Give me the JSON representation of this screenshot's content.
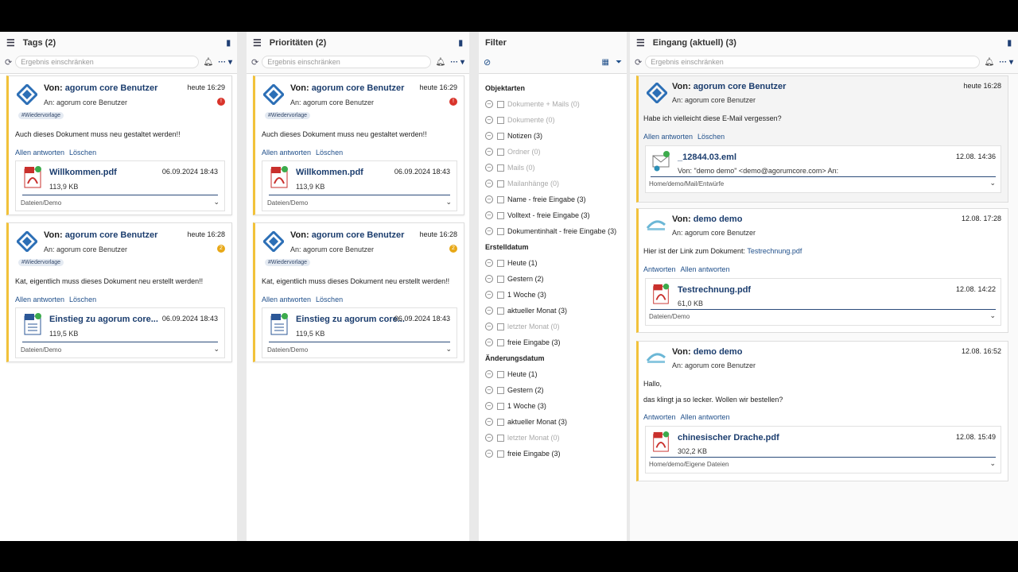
{
  "panels": {
    "tags": {
      "title": "Tags (2)",
      "search_placeholder": "Ergebnis einschränken"
    },
    "prio": {
      "title": "Prioritäten (2)",
      "search_placeholder": "Ergebnis einschränken"
    },
    "filter": {
      "title": "Filter"
    },
    "inbox": {
      "title": "Eingang (aktuell) (3)",
      "search_placeholder": "Ergebnis einschränken"
    }
  },
  "common": {
    "from_label": "Von:",
    "sender": "agorum core Benutzer",
    "to": "An: agorum core Benutzer",
    "tag": "#Wiedervorlage",
    "reply_all": "Allen antworten",
    "delete": "Löschen",
    "reply": "Antworten",
    "path_demo": "Dateien/Demo"
  },
  "cards": [
    {
      "time": "heute 16:29",
      "badge": "!",
      "message": "Auch dieses Dokument muss neu gestaltet werden!!",
      "file": "Willkommen.pdf",
      "file_date": "06.09.2024 18:43",
      "size_a": "113,9 KB"
    },
    {
      "time": "heute 16:28",
      "badge": "2",
      "message": "Kat, eigentlich muss dieses Dokument neu erstellt werden!!",
      "file": "Einstieg zu agorum core...",
      "file_date": "06.09.2024 18:43",
      "size_a": "119,5 KB"
    }
  ],
  "filter": {
    "sections": [
      {
        "title": "Objektarten",
        "items": [
          {
            "label": "Dokumente + Mails (0)",
            "dim": true
          },
          {
            "label": "Dokumente (0)",
            "dim": true
          },
          {
            "label": "Notizen (3)",
            "dim": false
          },
          {
            "label": "Ordner (0)",
            "dim": true
          },
          {
            "label": "Mails (0)",
            "dim": true
          },
          {
            "label": "Mailanhänge (0)",
            "dim": true
          },
          {
            "label": "Name - freie Eingabe (3)",
            "dim": false
          },
          {
            "label": "Volltext - freie Eingabe (3)",
            "dim": false
          },
          {
            "label": "Dokumentinhalt - freie Eingabe (3)",
            "dim": false
          }
        ]
      },
      {
        "title": "Erstelldatum",
        "items": [
          {
            "label": "Heute (1)",
            "dim": false
          },
          {
            "label": "Gestern (2)",
            "dim": false
          },
          {
            "label": "1 Woche (3)",
            "dim": false
          },
          {
            "label": "aktueller Monat (3)",
            "dim": false
          },
          {
            "label": "letzter Monat (0)",
            "dim": true
          },
          {
            "label": "freie Eingabe (3)",
            "dim": false
          }
        ]
      },
      {
        "title": "Änderungsdatum",
        "items": [
          {
            "label": "Heute (1)",
            "dim": false
          },
          {
            "label": "Gestern (2)",
            "dim": false
          },
          {
            "label": "1 Woche (3)",
            "dim": false
          },
          {
            "label": "aktueller Monat (3)",
            "dim": false
          },
          {
            "label": "letzter Monat (0)",
            "dim": true
          },
          {
            "label": "freie Eingabe (3)",
            "dim": false
          }
        ]
      }
    ]
  },
  "inbox": [
    {
      "sender": "agorum core Benutzer",
      "time": "heute 16:28",
      "body1": "Habe ich vielleicht diese E-Mail vergessen?",
      "body2": "",
      "actions": [
        "Allen antworten",
        "Löschen"
      ],
      "att_name": "_12844.03.eml",
      "att_date": "12.08. 14:36",
      "att_sub": "Von: \"demo demo\" <demo@agorumcore.com> An:",
      "att_path": "Home/demo/Mail/Entwürfe"
    },
    {
      "sender": "demo demo",
      "time": "12.08. 17:28",
      "body1": "Hier ist der Link zum Dokument:",
      "link": "Testrechnung.pdf",
      "body2": "",
      "actions": [
        "Antworten",
        "Allen antworten"
      ],
      "att_name": "Testrechnung.pdf",
      "att_date": "12.08. 14:22",
      "att_sub": "61,0 KB",
      "att_path": "Dateien/Demo"
    },
    {
      "sender": "demo demo",
      "time": "12.08. 16:52",
      "body1": "Hallo,",
      "body2": "das klingt ja so lecker. Wollen wir bestellen?",
      "actions": [
        "Antworten",
        "Allen antworten"
      ],
      "att_name": "chinesischer Drache.pdf",
      "att_date": "12.08. 15:49",
      "att_sub": "302,2 KB",
      "att_path": "Home/demo/Eigene Dateien"
    }
  ]
}
